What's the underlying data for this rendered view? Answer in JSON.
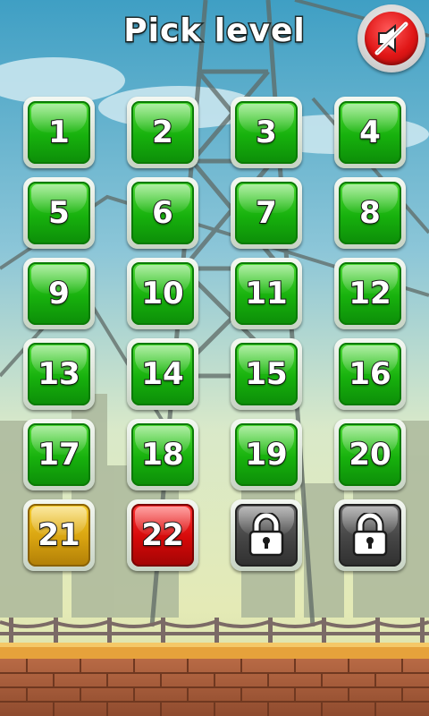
{
  "header": {
    "title": "Pick level"
  },
  "sound_button": {
    "icon": "speaker-muted-icon",
    "state": "muted",
    "color": "#e01616"
  },
  "levels": [
    {
      "label": "1",
      "state": "unlocked",
      "color": "green"
    },
    {
      "label": "2",
      "state": "unlocked",
      "color": "green"
    },
    {
      "label": "3",
      "state": "unlocked",
      "color": "green"
    },
    {
      "label": "4",
      "state": "unlocked",
      "color": "green"
    },
    {
      "label": "5",
      "state": "unlocked",
      "color": "green"
    },
    {
      "label": "6",
      "state": "unlocked",
      "color": "green"
    },
    {
      "label": "7",
      "state": "unlocked",
      "color": "green"
    },
    {
      "label": "8",
      "state": "unlocked",
      "color": "green"
    },
    {
      "label": "9",
      "state": "unlocked",
      "color": "green"
    },
    {
      "label": "10",
      "state": "unlocked",
      "color": "green"
    },
    {
      "label": "11",
      "state": "unlocked",
      "color": "green"
    },
    {
      "label": "12",
      "state": "unlocked",
      "color": "green"
    },
    {
      "label": "13",
      "state": "unlocked",
      "color": "green"
    },
    {
      "label": "14",
      "state": "unlocked",
      "color": "green"
    },
    {
      "label": "15",
      "state": "unlocked",
      "color": "green"
    },
    {
      "label": "16",
      "state": "unlocked",
      "color": "green"
    },
    {
      "label": "17",
      "state": "unlocked",
      "color": "green"
    },
    {
      "label": "18",
      "state": "unlocked",
      "color": "green"
    },
    {
      "label": "19",
      "state": "unlocked",
      "color": "green"
    },
    {
      "label": "20",
      "state": "unlocked",
      "color": "green"
    },
    {
      "label": "21",
      "state": "unlocked",
      "color": "yellow"
    },
    {
      "label": "22",
      "state": "current",
      "color": "red"
    },
    {
      "label": "",
      "state": "locked",
      "color": "locked",
      "icon": "padlock-icon"
    },
    {
      "label": "",
      "state": "locked",
      "color": "locked",
      "icon": "padlock-icon"
    }
  ]
}
